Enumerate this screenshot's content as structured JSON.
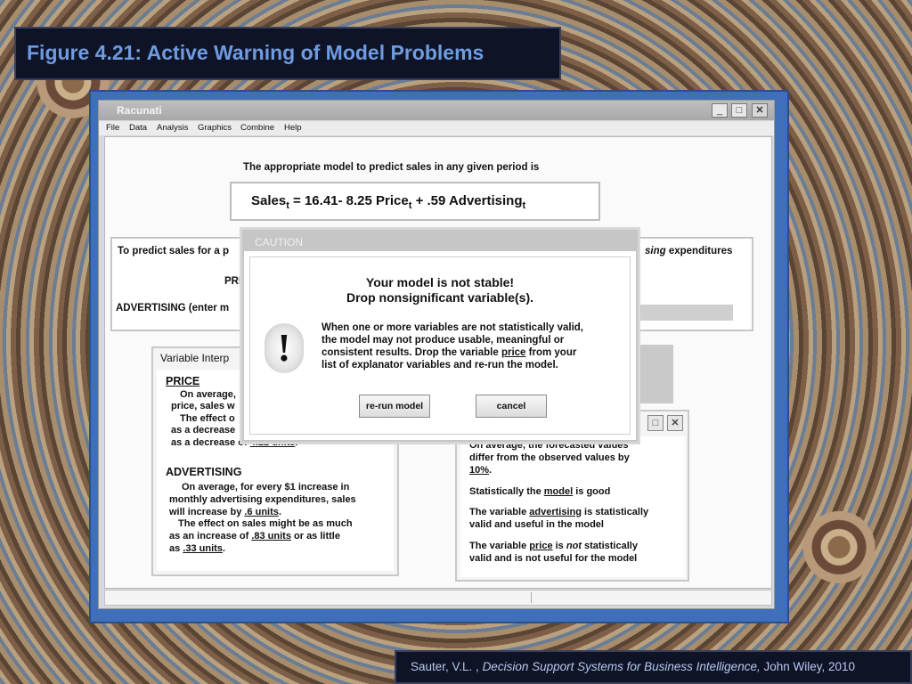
{
  "slide": {
    "title": "Figure 4.21:  Active Warning of Model Problems",
    "citation": {
      "author": "Sauter, V.L. , ",
      "book": "Decision Support Systems for Business Intelligence,",
      "publisher": " John Wiley, 2010"
    }
  },
  "window": {
    "title": "Racunati",
    "controls": [
      "minimize",
      "maximize",
      "close"
    ],
    "menu": [
      "File",
      "Data",
      "Analysis",
      "Graphics",
      "Combine",
      "Help"
    ]
  },
  "main": {
    "intro": "The appropriate model to predict sales in any given period is",
    "formula": {
      "lhs": "Sales",
      "sub": "t",
      "eq": " =  16.41- 8.25 Price",
      "sub2": "t",
      "mid": " + .59 Advertising",
      "sub3": "t"
    },
    "predict": {
      "line1_left": "To predict sales for a p",
      "line1_right_italic": "sing",
      "line1_right": " expenditures",
      "price_label": "PRI",
      "advertising_label": "ADVERTISING (enter m"
    }
  },
  "variable_panel": {
    "title": "Variable Interp",
    "price_head": "PRICE",
    "price_lines": [
      "On average,",
      "price, sales w",
      "The effect o",
      "as a decrease",
      "as a decrease of "
    ],
    "price_value": "4.22 units",
    "price_end": ".",
    "adv_head": "ADVERTISING",
    "adv_l1": "On average, for every $1 increase in",
    "adv_l2": "monthly advertising expenditures, sales",
    "adv_l3a": "will increase by ",
    "adv_l3b": ".6 units",
    "adv_l3c": ".",
    "adv_l4": "The effect on sales might be as much",
    "adv_l5a": "as an increase of ",
    "adv_l5b": ".83 units",
    "adv_l5c": " or as little",
    "adv_l6a": "as ",
    "adv_l6b": ".33 units",
    "adv_l6c": "."
  },
  "model_panel_fragment": "ms",
  "results_panel": {
    "l1": "On average, the forecasted values",
    "l2": "differ from the observed values by",
    "l3": "10%",
    "l3end": ".",
    "good_a": "Statistically the ",
    "good_b": "model",
    "good_c": " is good",
    "adv_a": "The variable ",
    "adv_b": "advertising",
    "adv_c": " is statistically",
    "adv_d": "valid and useful in the model",
    "price_a": "The variable ",
    "price_b": "price",
    "price_c": " is ",
    "price_not": "not",
    "price_d": " statistically",
    "price_e": "valid and is not useful for the model"
  },
  "caution": {
    "title": "CAUTION",
    "head1": "Your model is not stable!",
    "head2": "Drop nonsignificant variable(s).",
    "body1": "When one or more variables are not statistically valid,",
    "body2": "the model may not produce usable, meaningful or",
    "body3a": "consistent results.  Drop the variable ",
    "body3b": "price",
    "body3c": " from your",
    "body4": "list of explanator variables and re-run the model.",
    "icon": "!",
    "rerun_label": "re-run model",
    "cancel_label": "cancel"
  },
  "colors": {
    "title_text": "#6f9be0",
    "frame_blue": "#3f6fb8",
    "dark_box": "#0e1426"
  }
}
